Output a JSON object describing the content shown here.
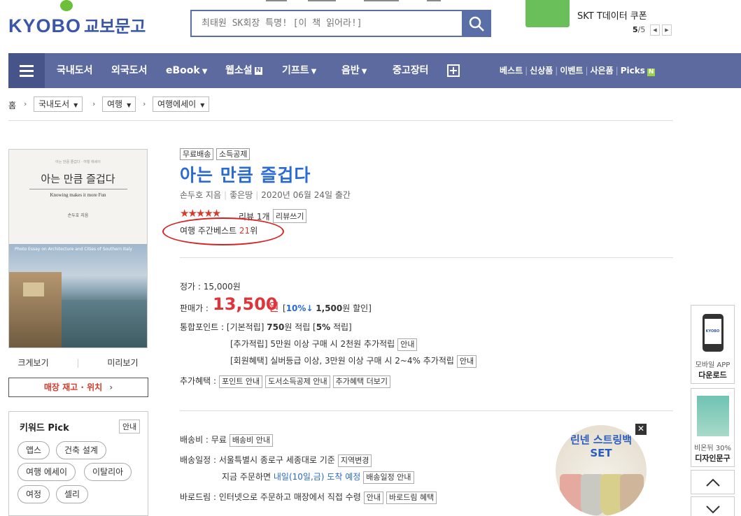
{
  "header": {
    "logo_text": "KYOBO",
    "logo_kr": "교보문고",
    "search_placeholder": "최태원 SK회장 특명! [이 책 읽어라!]",
    "promo_text": "SKT T데이터 쿠폰",
    "promo_page_current": "5",
    "promo_page_total": "/5"
  },
  "nav": {
    "items": [
      "국내도서",
      "외국도서",
      "eBook",
      "웹소설",
      "기프트",
      "음반",
      "중고장터"
    ],
    "n_badge": "N",
    "right_links": [
      "베스트",
      "신상품",
      "이벤트",
      "사은품",
      "Picks"
    ]
  },
  "breadcrumb": {
    "home": "홈",
    "levels": [
      "국내도서",
      "여행",
      "여행에세이"
    ]
  },
  "cover": {
    "small_line": "아는 만큼 즐겁다 · 여행 에세이",
    "title": "아는 만큼 즐겁다",
    "subtitle": "Knowing makes it more Fun",
    "author": "손두호 지음",
    "photo_text": "Photo Essay on Architecture and Cities of Southern Italy"
  },
  "preview": {
    "zoom": "크게보기",
    "sample": "미리보기"
  },
  "stock_button": "매장 재고 · 위치",
  "keyword": {
    "title": "키워드 Pick",
    "info": "안내",
    "tags": [
      "앱스",
      "건축 설계",
      "여행 에세이",
      "이탈리아",
      "여정",
      "셀리"
    ]
  },
  "product": {
    "tags": [
      "무료배송",
      "소득공제"
    ],
    "title": "아는 만큼 즐겁다",
    "author": "손두호 지음",
    "publisher": "좋은땅",
    "date": "2020년 06월 24일 출간",
    "stars": "★★★★★",
    "review_label": "리뷰 1개",
    "review_write": "리뷰쓰기",
    "weekly_prefix": "여행 주간베스트 ",
    "weekly_rank": "21",
    "weekly_suffix": "위",
    "list_price": "정가 : 15,000원",
    "sale_label": "판매가 :",
    "sale_price": "13,500",
    "sale_unit": "원",
    "discount_open": "[",
    "discount_pct": "10%↓",
    "discount_amt": "1,500",
    "discount_tail": "원 할인]",
    "points_label": "통합포인트 :",
    "points_basic": "[기본적립]",
    "points_basic_amt": "750",
    "points_basic_tail": "원 적립 [",
    "points_basic_pct": "5%",
    "points_basic_end": " 적립]",
    "points_add": "[추가적립] 5만원 이상 구매 시 2천원 추가적립",
    "points_member": "[회원혜택] 실버등급 이상, 3만원 이상 구매 시 2~4% 추가적립",
    "guide": "안내",
    "extra_label": "추가혜택 :",
    "extra_buttons": [
      "포인트 안내",
      "도서소득공제 안내",
      "추가혜택 더보기"
    ],
    "ship_label": "배송비 : 무료",
    "ship_btn": "배송비 안내",
    "schedule_label": "배송일정 : 서울특별시 종로구 세종대로 기준",
    "region_btn": "지역변경",
    "order_prefix": "지금 주문하면 ",
    "order_date": "내일(10일,금) 도착 예정",
    "schedule_btn": "배송일정 안내",
    "barodream_label": "바로드림 : 인터넷으로 주문하고 매장에서 직접 수령",
    "barodream_btn": "바로드림 혜택"
  },
  "side": {
    "app_cap1": "모바일 APP",
    "app_cap2": "다운로드",
    "app_screen": "KYOBO",
    "ad_cap1": "비온뒤 30%",
    "ad_cap2": "디자인문구"
  },
  "banner": {
    "line1": "린넨 스트링백",
    "line2": "SET",
    "close": "✕"
  },
  "colors": {
    "brand": "#3a56a6",
    "nav": "#5c6aa0",
    "price": "#e0343a",
    "title": "#2a6ad2"
  }
}
